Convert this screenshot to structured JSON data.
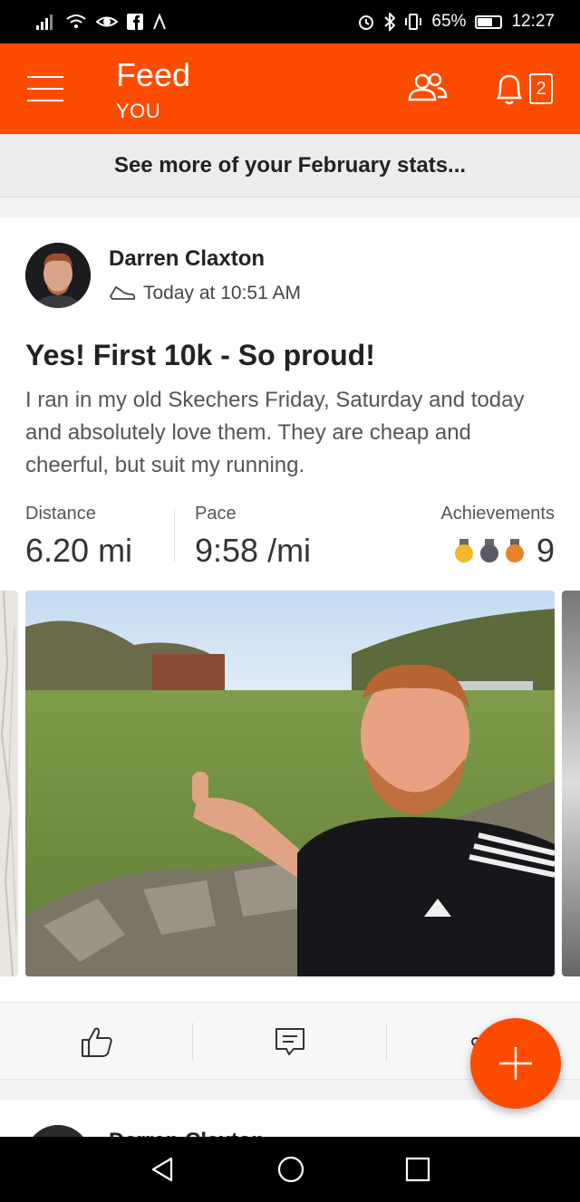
{
  "status_bar": {
    "battery": "65%",
    "time": "12:27"
  },
  "app_bar": {
    "title": "Feed",
    "subtitle": "YOU",
    "notification_count": "2"
  },
  "stats_banner": {
    "text": "See more of your February stats..."
  },
  "activity": {
    "athlete_name": "Darren Claxton",
    "timestamp": "Today at 10:51 AM",
    "activity_type_icon": "shoe-icon",
    "title": "Yes! First 10k - So proud!",
    "description": "I ran in my old Skechers Friday, Saturday and today and absolutely love them. They are cheap and cheerful, but suit my running.",
    "stats": {
      "distance_label": "Distance",
      "distance_value": "6.20 mi",
      "pace_label": "Pace",
      "pace_value": "9:58 /mi",
      "achievements_label": "Achievements",
      "achievements_count": "9"
    },
    "medal_colors": [
      "#f1b82d",
      "#5a5a66",
      "#e8832a"
    ]
  },
  "next_card": {
    "athlete_name": "Darren Claxton"
  },
  "colors": {
    "brand": "#fc4c02"
  }
}
